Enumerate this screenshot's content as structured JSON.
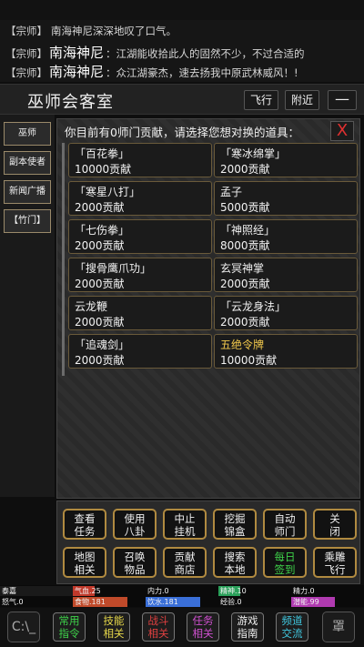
{
  "chat": [
    {
      "tag": "【宗师】",
      "speaker": "",
      "text": "南海神尼深深地叹了口气。"
    },
    {
      "tag": "【宗师】",
      "speaker": "南海神尼",
      "text": "：江湖能收拾此人的固然不少，不过合适的"
    },
    {
      "tag": "【宗师】",
      "speaker": "南海神尼",
      "text": "：众江湖豪杰，速去扬我中原武林威风！!"
    }
  ],
  "title_bar": {
    "room_title": "巫师会客室",
    "fly_label": "飞行",
    "nearby_label": "附近",
    "menu_label": "—"
  },
  "sidebar": {
    "items": [
      "巫师",
      "副本使者",
      "新闻广播",
      "【竹门】"
    ]
  },
  "panel": {
    "header": "你目前有0师门贡献，请选择您想对换的道具：",
    "close_label": "X",
    "items": [
      {
        "name": "「百花拳」",
        "cost": "10000贡献"
      },
      {
        "name": "「寒冰绵掌」",
        "cost": "2000贡献"
      },
      {
        "name": "「寒星八打」",
        "cost": "2000贡献"
      },
      {
        "name": "孟子",
        "cost": "5000贡献"
      },
      {
        "name": "「七伤拳」",
        "cost": "2000贡献"
      },
      {
        "name": "「神照经」",
        "cost": "8000贡献"
      },
      {
        "name": "「搜骨鹰爪功」",
        "cost": "2000贡献"
      },
      {
        "name": "玄冥神掌",
        "cost": "2000贡献"
      },
      {
        "name": "云龙鞭",
        "cost": "2000贡献"
      },
      {
        "name": "「云龙身法」",
        "cost": "2000贡献"
      },
      {
        "name": "「追魂剑」",
        "cost": "2000贡献"
      },
      {
        "name": "五绝令牌",
        "cost": "10000贡献"
      }
    ]
  },
  "actions": [
    {
      "l1": "查看",
      "l2": "任务"
    },
    {
      "l1": "使用",
      "l2": "八卦"
    },
    {
      "l1": "中止",
      "l2": "挂机"
    },
    {
      "l1": "挖掘",
      "l2": "锦盒"
    },
    {
      "l1": "自动",
      "l2": "师门"
    },
    {
      "l1": "关",
      "l2": "闭"
    },
    {
      "l1": "地图",
      "l2": "相关"
    },
    {
      "l1": "召唤",
      "l2": "物品"
    },
    {
      "l1": "贡献",
      "l2": "商店"
    },
    {
      "l1": "搜索",
      "l2": "本地"
    },
    {
      "l1": "每日",
      "l2": "签到"
    },
    {
      "l1": "乘雕",
      "l2": "飞行"
    }
  ],
  "stats": [
    {
      "label": "泰嘉",
      "color": "#ffffff",
      "level": 1.0
    },
    {
      "label": "气血.25",
      "color": "#c0392b",
      "level": 0.3
    },
    {
      "label": "内力.0",
      "color": "#2a5fb5",
      "level": 0.0
    },
    {
      "label": "精神.10",
      "color": "#2aa05a",
      "level": 0.3
    },
    {
      "label": "精力.0",
      "color": "#8e44ad",
      "level": 0.0
    },
    {
      "label": "怒气.0",
      "color": "#666666",
      "level": 0.0
    },
    {
      "label": "食物.181",
      "color": "#c04a2a",
      "level": 0.75
    },
    {
      "label": "饮水.181",
      "color": "#3a6fd8",
      "level": 0.75
    },
    {
      "label": "经验.0",
      "color": "#7a7a7a",
      "level": 0.0
    },
    {
      "label": "潜能.99",
      "color": "#b03ab0",
      "level": 0.6
    }
  ],
  "bottom_nav": [
    {
      "l1": "常用",
      "l2": "指令",
      "color": "#3ed34a"
    },
    {
      "l1": "技能",
      "l2": "相关",
      "color": "#e6d84a"
    },
    {
      "l1": "战斗",
      "l2": "相关",
      "color": "#e04040"
    },
    {
      "l1": "任务",
      "l2": "相关",
      "color": "#d050d0"
    },
    {
      "l1": "游戏",
      "l2": "指南",
      "color": "#f0f0f0"
    },
    {
      "l1": "频道",
      "l2": "交流",
      "color": "#40c8e0"
    }
  ],
  "bottom_icons": {
    "left": "terminal-icon",
    "right": "robot-icon",
    "left_text": "C:\\_",
    "right_text": "罩"
  }
}
